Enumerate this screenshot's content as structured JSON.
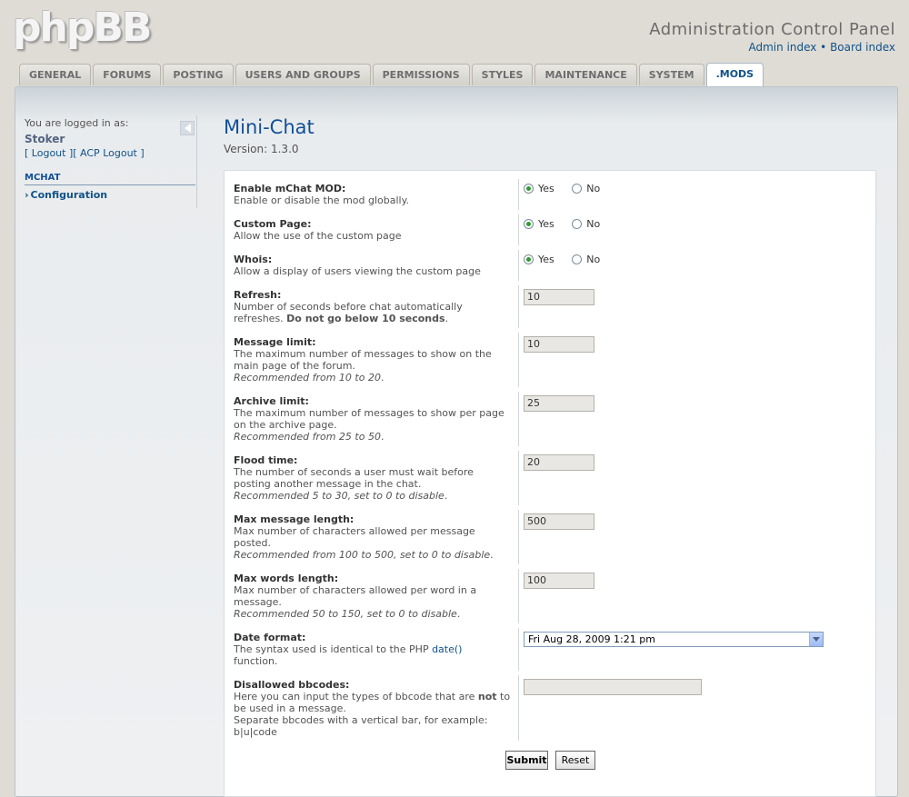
{
  "header": {
    "logo_text": "phpBB",
    "title": "Administration Control Panel",
    "links": {
      "admin_index": "Admin index",
      "separator": "•",
      "board_index": "Board index"
    }
  },
  "tabs": [
    {
      "label": "GENERAL",
      "active": false
    },
    {
      "label": "FORUMS",
      "active": false
    },
    {
      "label": "POSTING",
      "active": false
    },
    {
      "label": "USERS AND GROUPS",
      "active": false
    },
    {
      "label": "PERMISSIONS",
      "active": false
    },
    {
      "label": "STYLES",
      "active": false
    },
    {
      "label": "MAINTENANCE",
      "active": false
    },
    {
      "label": "SYSTEM",
      "active": false
    },
    {
      "label": ".MODS",
      "active": true
    }
  ],
  "sidebar": {
    "logged_in_label": "You are logged in as:",
    "username": "Stoker",
    "logout_open": "[ ",
    "logout": "Logout",
    "mid": " ][ ",
    "acp_logout": "ACP Logout",
    "logout_close": " ]",
    "menu_header": "MCHAT",
    "menu_item_bullet": "›",
    "menu_item": "Configuration"
  },
  "page": {
    "title": "Mini-Chat",
    "version": "Version: 1.3.0"
  },
  "settings": {
    "yes": "Yes",
    "no": "No",
    "enable": {
      "label": "Enable mChat MOD:",
      "desc": "Enable or disable the mod globally."
    },
    "custom_page": {
      "label": "Custom Page:",
      "desc": "Allow the use of the custom page"
    },
    "whois": {
      "label": "Whois:",
      "desc": "Allow a display of users viewing the custom page"
    },
    "refresh": {
      "label": "Refresh:",
      "desc": "Number of seconds before chat automatically refreshes.",
      "warn": "Do not go below 10 seconds",
      "value": "10"
    },
    "message_limit": {
      "label": "Message limit:",
      "desc": "The maximum number of messages to show on the main page of the forum.",
      "rec": "Recommended from 10 to 20",
      "value": "10"
    },
    "archive_limit": {
      "label": "Archive limit:",
      "desc": "The maximum number of messages to show per page on the archive page.",
      "rec": "Recommended from 25 to 50",
      "value": "25"
    },
    "flood_time": {
      "label": "Flood time:",
      "desc": "The number of seconds a user must wait before posting another message in the chat.",
      "rec": "Recommended 5 to 30, set to 0 to disable",
      "value": "20"
    },
    "max_message_length": {
      "label": "Max message length:",
      "desc": "Max number of characters allowed per message posted.",
      "rec": "Recommended from 100 to 500, set to 0 to disable",
      "value": "500"
    },
    "max_words_length": {
      "label": "Max words length:",
      "desc": "Max number of characters allowed per word in a message.",
      "rec": "Recommended 50 to 150, set to 0 to disable",
      "value": "100"
    },
    "date_format": {
      "label": "Date format:",
      "desc_pre": "The syntax used is identical to the PHP ",
      "link": "date()",
      "desc_post": " function.",
      "value": "Fri Aug 28, 2009 1:21 pm"
    },
    "disallowed_bbcodes": {
      "label": "Disallowed bbcodes:",
      "desc_pre": "Here you can input the types of bbcode that are ",
      "not": "not",
      "desc_post": " to be used in a message.",
      "desc2": "Separate bbcodes with a vertical bar, for example:",
      "example": "b|u|code",
      "value": ""
    }
  },
  "buttons": {
    "submit": "Submit",
    "reset": "Reset"
  }
}
